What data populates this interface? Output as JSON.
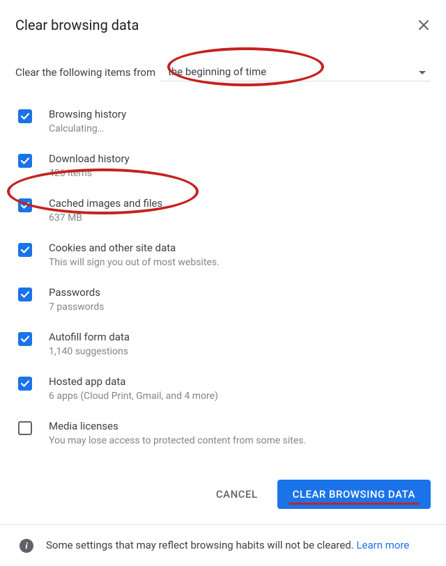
{
  "header": {
    "title": "Clear browsing data"
  },
  "time": {
    "prefix": "Clear the following items from",
    "selected": "the beginning of time"
  },
  "items": [
    {
      "label": "Browsing history",
      "sub": "Calculating…",
      "checked": true
    },
    {
      "label": "Download history",
      "sub": "426 items",
      "checked": true
    },
    {
      "label": "Cached images and files",
      "sub": "637 MB",
      "checked": true
    },
    {
      "label": "Cookies and other site data",
      "sub": "This will sign you out of most websites.",
      "checked": true
    },
    {
      "label": "Passwords",
      "sub": "7 passwords",
      "checked": true
    },
    {
      "label": "Autofill form data",
      "sub": "1,140 suggestions",
      "checked": true
    },
    {
      "label": "Hosted app data",
      "sub": "6 apps (Cloud Print, Gmail, and 4 more)",
      "checked": true
    },
    {
      "label": "Media licenses",
      "sub": "You may lose access to protected content from some sites.",
      "checked": false
    }
  ],
  "actions": {
    "cancel": "CANCEL",
    "primary": "CLEAR BROWSING DATA"
  },
  "footer": {
    "text": "Some settings that may reflect browsing habits will not be cleared.  ",
    "link": "Learn more"
  }
}
